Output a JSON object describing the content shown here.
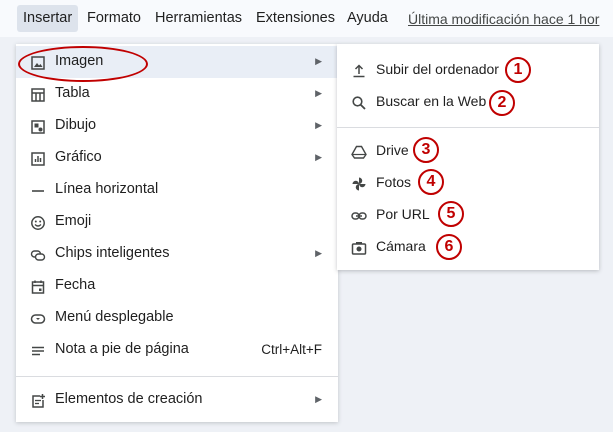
{
  "menubar": {
    "items": [
      "Insertar",
      "Formato",
      "Herramientas",
      "Extensiones",
      "Ayuda"
    ],
    "last_modified": "Última modificación hace 1 hor"
  },
  "insert_menu": {
    "items": [
      {
        "label": "Imagen",
        "icon": "image-icon",
        "submenu": true,
        "highlighted": true
      },
      {
        "label": "Tabla",
        "icon": "table-icon",
        "submenu": true
      },
      {
        "label": "Dibujo",
        "icon": "drawing-icon",
        "submenu": true
      },
      {
        "label": "Gráfico",
        "icon": "chart-icon",
        "submenu": true
      },
      {
        "label": "Línea horizontal",
        "icon": "horizontal-line-icon"
      },
      {
        "label": "Emoji",
        "icon": "emoji-icon"
      },
      {
        "label": "Chips inteligentes",
        "icon": "smart-chips-icon",
        "submenu": true
      },
      {
        "label": "Fecha",
        "icon": "calendar-icon"
      },
      {
        "label": "Menú desplegable",
        "icon": "dropdown-icon"
      },
      {
        "label": "Nota a pie de página",
        "icon": "footnote-icon",
        "shortcut": "Ctrl+Alt+F"
      },
      {
        "label": "Elementos de creación",
        "icon": "building-blocks-icon",
        "submenu": true
      }
    ]
  },
  "image_submenu": {
    "items": [
      {
        "label": "Subir del ordenador",
        "icon": "upload-icon",
        "badge": "1"
      },
      {
        "label": "Buscar en la Web",
        "icon": "search-icon",
        "badge": "2"
      },
      {
        "label": "Drive",
        "icon": "drive-icon",
        "badge": "3"
      },
      {
        "label": "Fotos",
        "icon": "photos-pinwheel-icon",
        "badge": "4"
      },
      {
        "label": "Por URL",
        "icon": "link-icon",
        "badge": "5"
      },
      {
        "label": "Cámara",
        "icon": "camera-icon",
        "badge": "6"
      }
    ]
  },
  "colors": {
    "annotation": "#c00000",
    "highlight": "#e9eef6",
    "icon": "#444746"
  }
}
